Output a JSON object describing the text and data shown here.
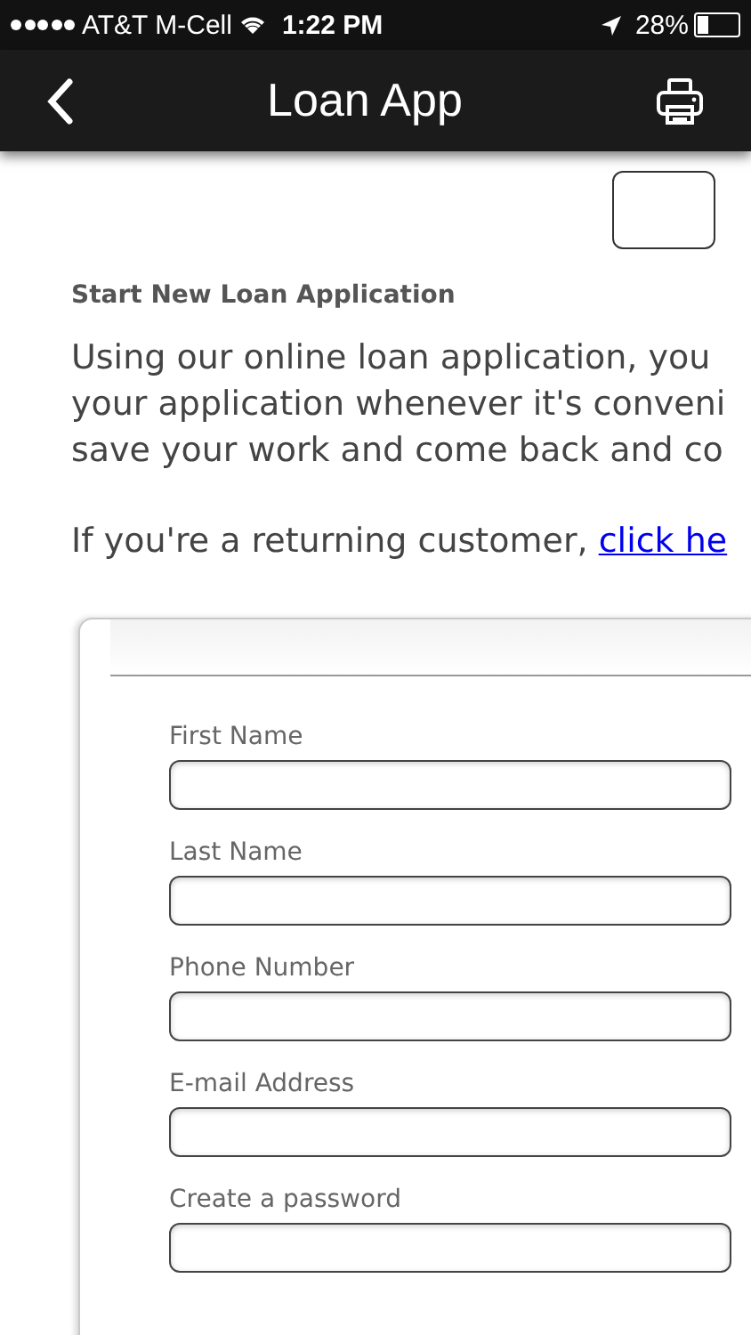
{
  "status_bar": {
    "carrier": "AT&T M-Cell",
    "time": "1:22 PM",
    "battery": "28%"
  },
  "nav_bar": {
    "title": "Loan App"
  },
  "heading": "Start New Loan Application",
  "intro_lines": [
    "Using our online loan application, you",
    "your application whenever it's conveni",
    "save your work and come back and co"
  ],
  "returning": {
    "text": "If you're a returning customer, ",
    "link": "click he"
  },
  "form": {
    "fields": [
      {
        "label": "First Name"
      },
      {
        "label": "Last Name"
      },
      {
        "label": "Phone Number"
      },
      {
        "label": "E-mail Address"
      },
      {
        "label": "Create a password"
      }
    ]
  }
}
